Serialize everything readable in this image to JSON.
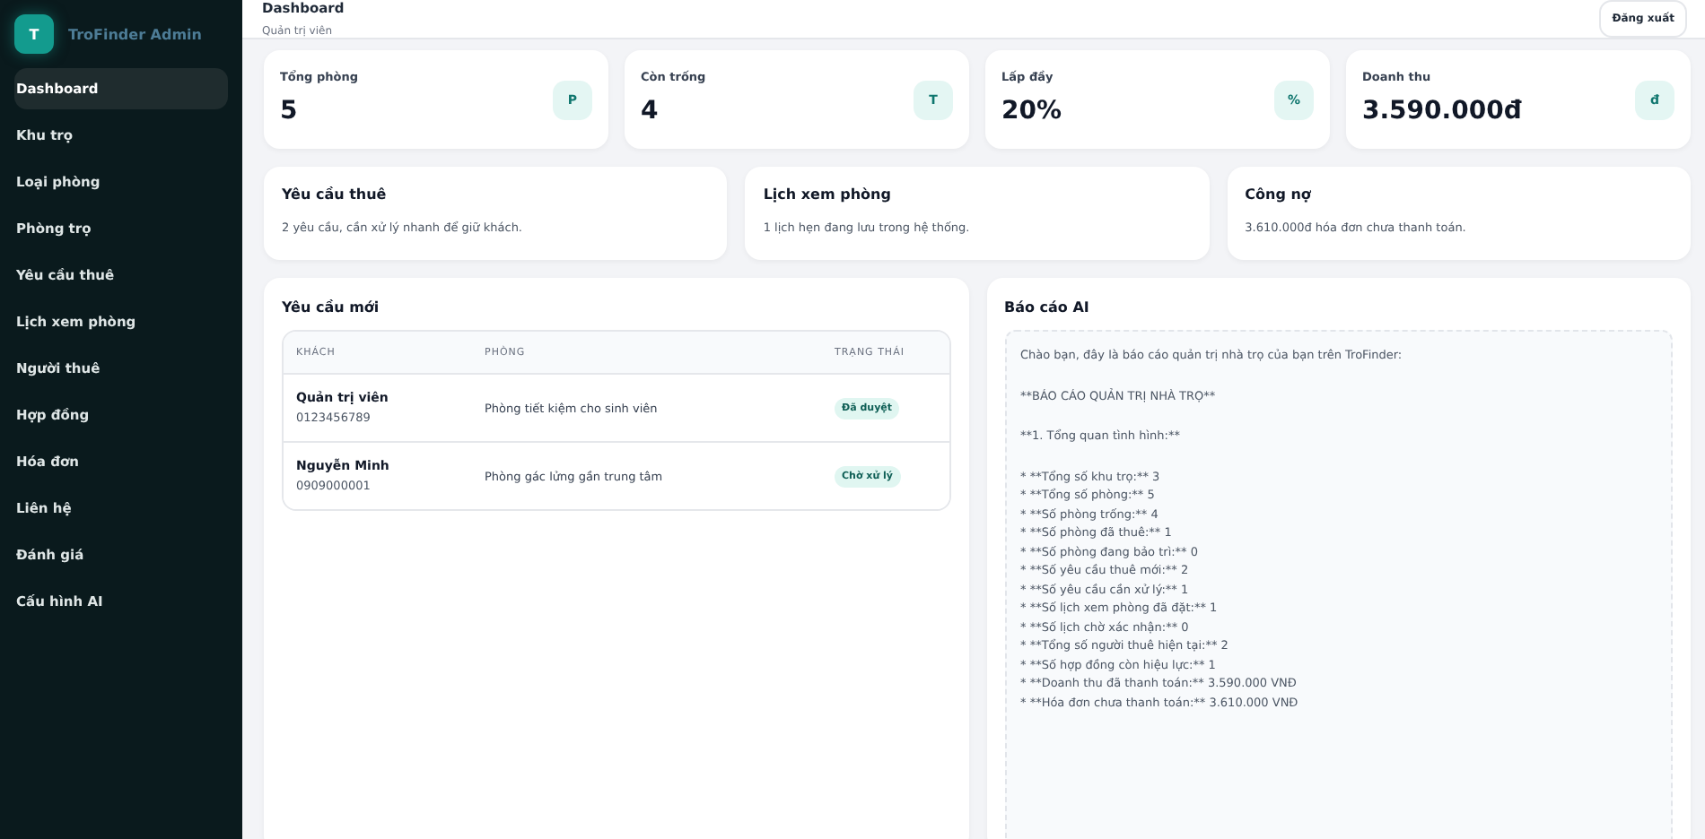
{
  "sidebar": {
    "brand": {
      "logo": "T",
      "name": "TroFinder Admin"
    },
    "items": [
      {
        "label": "Dashboard",
        "selected": true
      },
      {
        "label": "Khu trọ",
        "selected": false
      },
      {
        "label": "Loại phòng",
        "selected": false
      },
      {
        "label": "Phòng trọ",
        "selected": false
      },
      {
        "label": "Yêu cầu thuê",
        "selected": false
      },
      {
        "label": "Lịch xem phòng",
        "selected": false
      },
      {
        "label": "Người thuê",
        "selected": false
      },
      {
        "label": "Hợp đồng",
        "selected": false
      },
      {
        "label": "Hóa đơn",
        "selected": false
      },
      {
        "label": "Liên hệ",
        "selected": false
      },
      {
        "label": "Đánh giá",
        "selected": false
      },
      {
        "label": "Cấu hình AI",
        "selected": false
      }
    ]
  },
  "header": {
    "title": "Dashboard",
    "subtitle": "Quản trị viên",
    "logout": "Đăng xuất"
  },
  "stats": [
    {
      "label": "Tổng phòng",
      "value": "5",
      "icon": "P"
    },
    {
      "label": "Còn trống",
      "value": "4",
      "icon": "T"
    },
    {
      "label": "Lấp đầy",
      "value": "20%",
      "icon": "%"
    },
    {
      "label": "Doanh thu",
      "value": "3.590.000đ",
      "icon": "đ"
    }
  ],
  "summaries": [
    {
      "title": "Yêu cầu thuê",
      "text": "2 yêu cầu, cần xử lý nhanh để giữ khách."
    },
    {
      "title": "Lịch xem phòng",
      "text": "1 lịch hẹn đang lưu trong hệ thống."
    },
    {
      "title": "Công nợ",
      "text": "3.610.000đ hóa đơn chưa thanh toán."
    }
  ],
  "requests": {
    "title": "Yêu cầu mới",
    "columns": [
      "KHÁCH",
      "PHÒNG",
      "TRẠNG THÁI"
    ],
    "rows": [
      {
        "name": "Quản trị viên",
        "phone": "0123456789",
        "room": "Phòng tiết kiệm cho sinh viên",
        "status": "Đã duyệt"
      },
      {
        "name": "Nguyễn Minh",
        "phone": "0909000001",
        "room": "Phòng gác lửng gần trung tâm",
        "status": "Chờ xử lý"
      }
    ]
  },
  "report": {
    "title": "Báo cáo AI",
    "paragraphs": [
      [
        "Chào bạn, đây là báo cáo quản trị nhà trọ của bạn trên TroFinder:"
      ],
      [
        "**BÁO CÁO QUẢN TRỊ NHÀ TRỌ**"
      ],
      [
        "**1. Tổng quan tình hình:**"
      ],
      [
        "* **Tổng số khu trọ:** 3",
        "* **Tổng số phòng:** 5",
        "* **Số phòng trống:** 4",
        "* **Số phòng đã thuê:** 1",
        "* **Số phòng đang bảo trì:** 0",
        "* **Số yêu cầu thuê mới:** 2",
        "* **Số yêu cầu cần xử lý:** 1",
        "* **Số lịch xem phòng đã đặt:** 1",
        "* **Số lịch chờ xác nhận:** 0",
        "* **Tổng số người thuê hiện tại:** 2",
        "* **Số hợp đồng còn hiệu lực:** 1",
        "* **Doanh thu đã thanh toán:** 3.590.000 VNĐ",
        "* **Hóa đơn chưa thanh toán:** 3.610.000 VNĐ"
      ]
    ]
  }
}
